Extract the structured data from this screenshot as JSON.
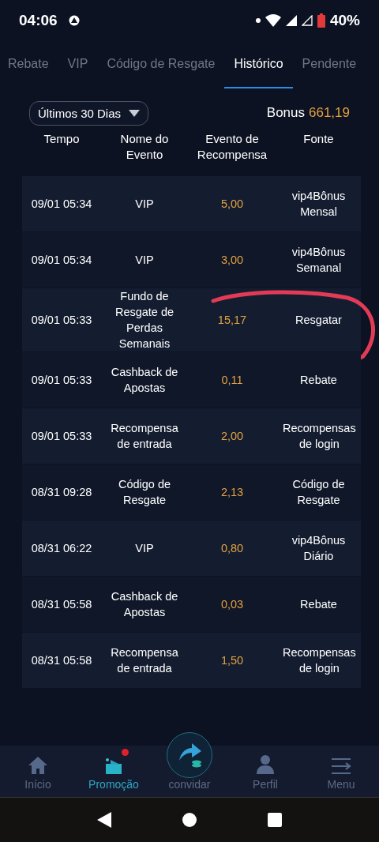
{
  "status_bar": {
    "time": "04:06",
    "battery": "40%"
  },
  "tabs": [
    {
      "label": "Rebate",
      "selected": false
    },
    {
      "label": "VIP",
      "selected": false
    },
    {
      "label": "Código de Resgate",
      "selected": false
    },
    {
      "label": "Histórico",
      "selected": true
    },
    {
      "label": "Pendente",
      "selected": false
    }
  ],
  "filter": {
    "value": "Últimos 30 Dias"
  },
  "bonus": {
    "label": "Bonus",
    "value": "661,19"
  },
  "table": {
    "columns": [
      "Tempo",
      "Nome do Evento",
      "Evento de Recompensa",
      "Fonte"
    ],
    "rows": [
      {
        "cells": [
          "09/01 05:34",
          "VIP",
          "5,00",
          "vip4Bônus Mensal"
        ],
        "circled": false
      },
      {
        "cells": [
          "09/01 05:34",
          "VIP",
          "3,00",
          "vip4Bônus Semanal"
        ],
        "circled": false
      },
      {
        "cells": [
          "09/01 05:33",
          "Fundo de Resgate de Perdas Semanais",
          "15,17",
          "Resgatar"
        ],
        "circled": true
      },
      {
        "cells": [
          "09/01 05:33",
          "Cashback de Apostas",
          "0,11",
          "Rebate"
        ],
        "circled": false
      },
      {
        "cells": [
          "09/01 05:33",
          "Recompensa de entrada",
          "2,00",
          "Recompensas de login"
        ],
        "circled": false
      },
      {
        "cells": [
          "08/31 09:28",
          "Código de Resgate",
          "2,13",
          "Código de Resgate"
        ],
        "circled": false
      },
      {
        "cells": [
          "08/31 06:22",
          "VIP",
          "0,80",
          "vip4Bônus Diário"
        ],
        "circled": false
      },
      {
        "cells": [
          "08/31 05:58",
          "Cashback de Apostas",
          "0,03",
          "Rebate"
        ],
        "circled": false
      },
      {
        "cells": [
          "08/31 05:58",
          "Recompensa de entrada",
          "1,50",
          "Recompensas de login"
        ],
        "circled": false
      }
    ]
  },
  "bottom_nav": [
    {
      "label": "Início",
      "kind": "home",
      "selected": false,
      "badge": false
    },
    {
      "label": "Promoção",
      "kind": "promo",
      "selected": true,
      "badge": true
    },
    {
      "label": "convidar",
      "kind": "invite",
      "selected": false,
      "badge": false
    },
    {
      "label": "Perfil",
      "kind": "profile",
      "selected": false,
      "badge": false
    },
    {
      "label": "Menu",
      "kind": "menu",
      "selected": false,
      "badge": false
    }
  ]
}
